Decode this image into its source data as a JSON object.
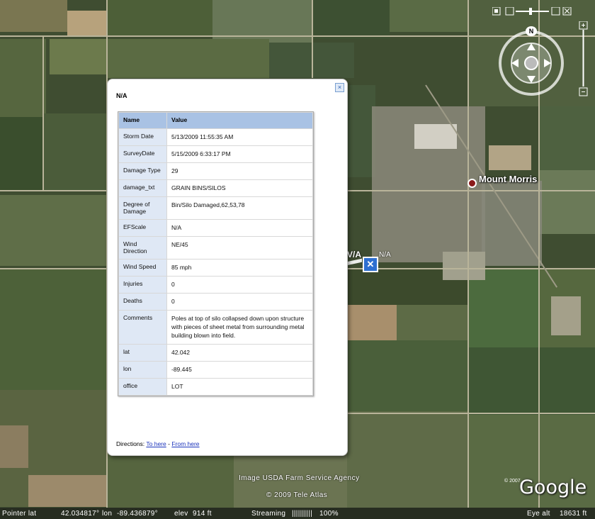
{
  "map": {
    "town_label": "Mount Morris",
    "marker_label": "N/A",
    "marker_label_partial": "V/A",
    "imagery_credit": "Image USDA Farm Service Agency",
    "copyright_teleatlas": "© 2009 Tele Atlas",
    "copyright_2007": "© 2007",
    "google_logo": "Google",
    "compass_north": "N",
    "nav_icons": [
      "compass-ring",
      "look-joystick",
      "move-joystick",
      "zoom-slider"
    ]
  },
  "statusbar": {
    "pointer_lat_label": "Pointer  lat",
    "pointer_lat": "42.034817°",
    "lon_label": "lon",
    "lon": "-89.436879°",
    "elev_label": "elev",
    "elev": "914 ft",
    "streaming_label": "Streaming",
    "streaming_bar": "||||||||||",
    "streaming_pct": "100%",
    "eye_alt_label": "Eye alt",
    "eye_alt": "18631 ft"
  },
  "balloon": {
    "title": "N/A",
    "table_headers": [
      "Name",
      "Value"
    ],
    "rows": [
      {
        "name": "Storm Date",
        "value": "5/13/2009 11:55:35 AM"
      },
      {
        "name": "SurveyDate",
        "value": "5/15/2009 6:33:17 PM"
      },
      {
        "name": "Damage Type",
        "value": "29"
      },
      {
        "name": "damage_txt",
        "value": "GRAIN BINS/SILOS"
      },
      {
        "name": "Degree of Damage",
        "value": "Bin/Silo Damaged,62,53,78"
      },
      {
        "name": "EFScale",
        "value": "N/A"
      },
      {
        "name": "Wind Direction",
        "value": "NE/45"
      },
      {
        "name": "Wind Speed",
        "value": "85 mph"
      },
      {
        "name": "Injuries",
        "value": "0"
      },
      {
        "name": "Deaths",
        "value": "0"
      },
      {
        "name": "Comments",
        "value": "Poles at top of silo collapsed down upon structure with pieces of sheet metal from surrounding metal building blown into field."
      },
      {
        "name": "lat",
        "value": "42.042"
      },
      {
        "name": "lon",
        "value": "-89.445"
      },
      {
        "name": "office",
        "value": "LOT"
      }
    ],
    "directions_label": "Directions:",
    "to_here": "To here",
    "separator": "-",
    "from_here": "From here"
  }
}
